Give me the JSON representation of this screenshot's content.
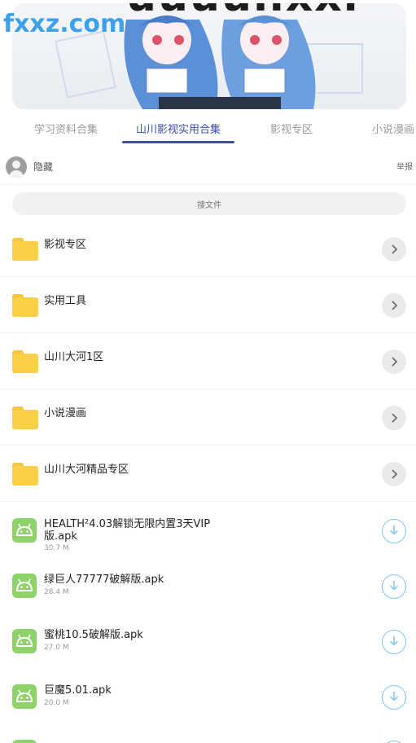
{
  "banner": {
    "big_text": "uuuuiixxi",
    "watermark": "fxxz.com"
  },
  "tabs": [
    {
      "label": "学习资料合集"
    },
    {
      "label": "山川影视实用合集"
    },
    {
      "label": "影视专区"
    },
    {
      "label": "小说漫画"
    }
  ],
  "user": {
    "name": "隐藏",
    "report_label": "举报"
  },
  "search": {
    "placeholder": "搜文件"
  },
  "folders": [
    {
      "name": "影视专区"
    },
    {
      "name": "实用工具"
    },
    {
      "name": "山川大河1区"
    },
    {
      "name": "小说漫画"
    },
    {
      "name": "山川大河精品专区"
    }
  ],
  "files": [
    {
      "name": "HEALTH²4.03解锁无限内置3天VIP版.apk",
      "size": "30.7 M"
    },
    {
      "name": "绿巨人77777破解版.apk",
      "size": "28.4 M"
    },
    {
      "name": "蜜桃10.5破解版.apk",
      "size": "27.0 M"
    },
    {
      "name": "巨魔5.01.apk",
      "size": "20.0 M"
    }
  ],
  "colors": {
    "accent": "#3a4fa8",
    "folder": "#fbcf48",
    "apk": "#8fd16a",
    "download": "#7ec7f0"
  }
}
